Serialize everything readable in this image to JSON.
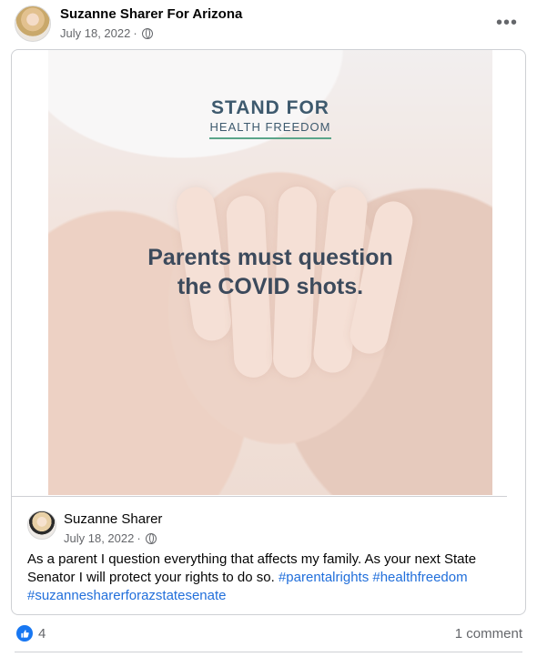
{
  "post": {
    "page_name": "Suzanne Sharer For Arizona",
    "date": "July 18, 2022",
    "dot": "·",
    "more_icon": "more-options-icon"
  },
  "image": {
    "brand_top": "STAND FOR",
    "brand_bottom": "HEALTH FREEDOM",
    "headline_line1": "Parents must question",
    "headline_line2": "the COVID shots."
  },
  "shared": {
    "author": "Suzanne Sharer",
    "date": "July 18, 2022",
    "dot": "·",
    "text_plain": "As a parent I question everything that affects my family. As your next State Senator I will protect your rights to do so. ",
    "hashtag1": "#parentalrights",
    "hashtag2": "#healthfreedom",
    "hashtag3": "#suzannesharerforazstatesenate"
  },
  "reactions": {
    "like_count": "4",
    "comment_count": "1 comment",
    "like_color": "#1877f2"
  }
}
